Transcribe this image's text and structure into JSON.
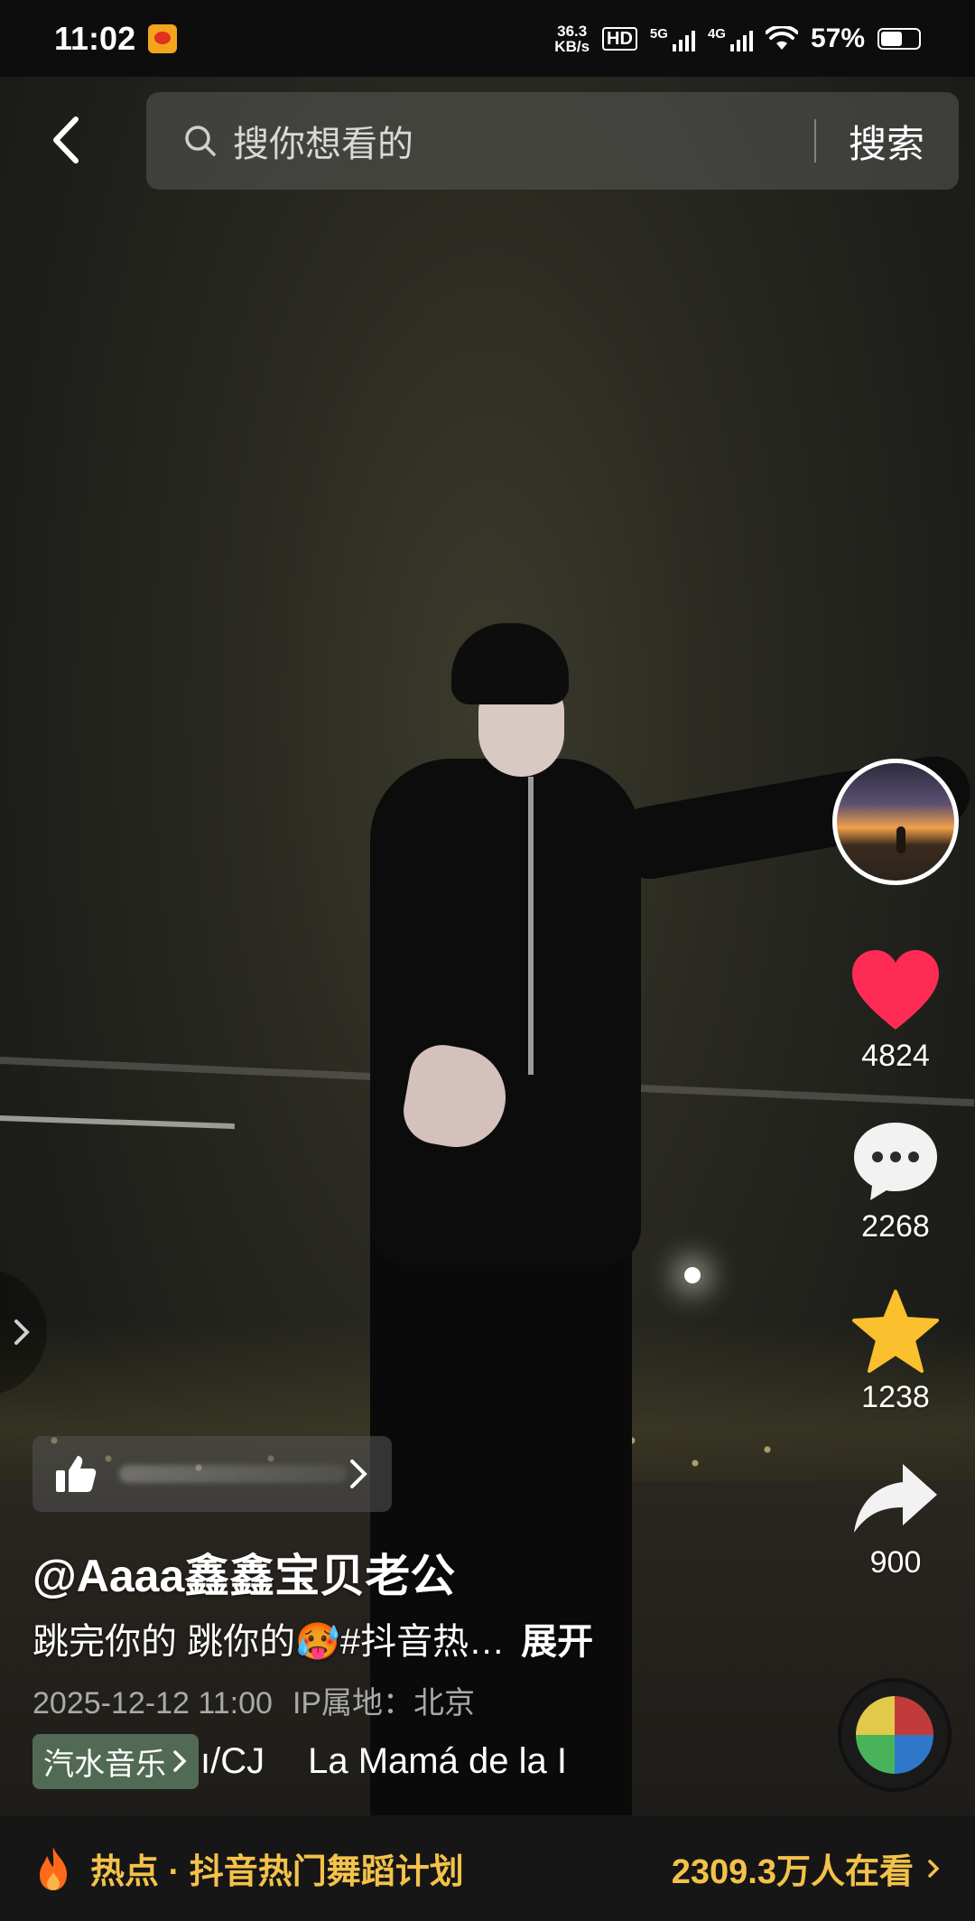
{
  "status_bar": {
    "time": "11:02",
    "net_speed_value": "36.3",
    "net_speed_unit": "KB/s",
    "hd_label": "HD",
    "signal_1_label": "5G",
    "signal_2_label": "4G",
    "battery_percent": "57%",
    "battery_level": 0.57
  },
  "search": {
    "placeholder": "搜你想看的",
    "button_label": "搜索"
  },
  "sidebar": {
    "like_count": "4824",
    "comment_count": "2268",
    "favorite_count": "1238",
    "share_count": "900"
  },
  "video_info": {
    "author": "@Aaaa鑫鑫宝贝老公",
    "caption": "跳完你的 跳你的🥵#抖音热…",
    "expand_label": "展开",
    "timestamp": "2025-12-12 11:00",
    "ip_location": "IP属地：北京"
  },
  "music": {
    "tag_label": "汽水音乐",
    "track_start": "ı/CJ",
    "track_name": "La Mamá de la I"
  },
  "hot_bar": {
    "text": "热点 · 抖音热门舞蹈计划",
    "viewers": "2309.3万人在看"
  },
  "colors": {
    "like_red": "#fe2c55",
    "favorite_yellow": "#fbc02d",
    "hot_gold": "#f3c24a"
  }
}
